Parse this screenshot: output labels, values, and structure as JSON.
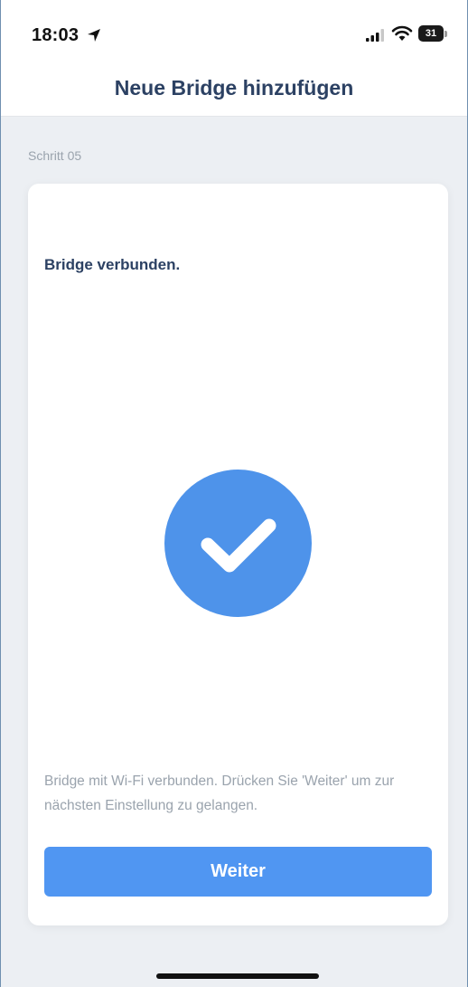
{
  "status_bar": {
    "time": "18:03",
    "battery_level": "31"
  },
  "header": {
    "title": "Neue Bridge hinzufügen"
  },
  "step": {
    "label": "Schritt 05"
  },
  "card": {
    "heading": "Bridge verbunden.",
    "description": "Bridge mit Wi-Fi verbunden. Drücken Sie 'Weiter' um zur nächsten Einstellung zu gelangen.",
    "button_label": "Weiter",
    "success_icon": "checkmark-icon"
  },
  "colors": {
    "accent": "#5096f2",
    "title": "#2c4163",
    "muted_text": "#9aa3ad",
    "background": "#eceff3"
  }
}
